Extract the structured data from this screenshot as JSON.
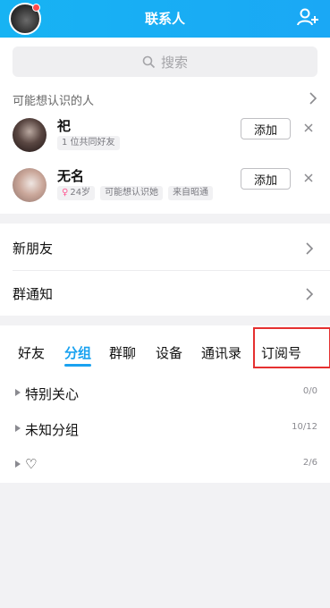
{
  "header": {
    "title": "联系人",
    "accent": "#17b3f3"
  },
  "search": {
    "placeholder": "搜索"
  },
  "recommend": {
    "title": "可能想认识的人",
    "people": [
      {
        "name": "祀",
        "tags": [
          "1 位共同好友"
        ],
        "add_label": "添加"
      },
      {
        "name": "无名",
        "age_tag": "24岁",
        "tags": [
          "可能想认识她",
          "来自昭通"
        ],
        "add_label": "添加"
      }
    ]
  },
  "entries": [
    {
      "label": "新朋友"
    },
    {
      "label": "群通知"
    }
  ],
  "tabs": [
    "好友",
    "分组",
    "群聊",
    "设备",
    "通讯录",
    "订阅号"
  ],
  "active_tab": "分组",
  "highlight_color": "#e53030",
  "groups": [
    {
      "name": "特别关心",
      "count": "0/0"
    },
    {
      "name": "未知分组",
      "count": "10/12"
    },
    {
      "name": "♡",
      "count": "2/6"
    }
  ],
  "icons": [
    "avatar",
    "add-friend-icon",
    "search-icon",
    "chevron-right-icon",
    "close-icon",
    "triangle-right-icon"
  ]
}
